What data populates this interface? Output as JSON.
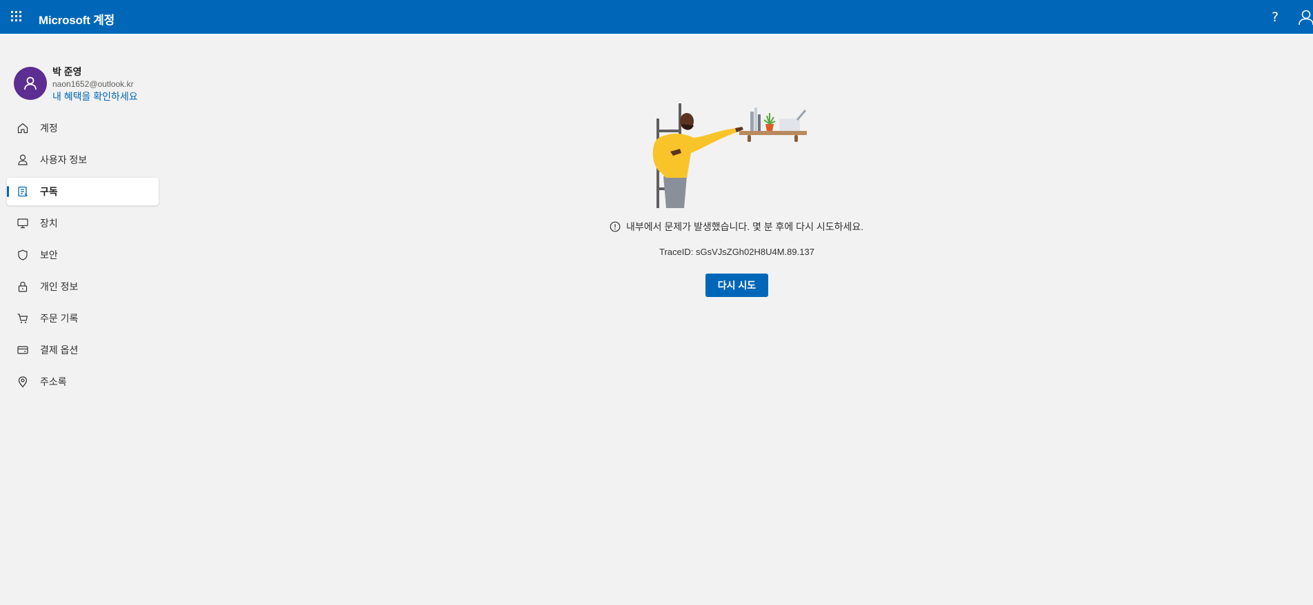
{
  "header": {
    "brand": "Microsoft 계정",
    "help": "?"
  },
  "profile": {
    "name": "박 준영",
    "email": "naon1652@outlook.kr",
    "benefits_link": "내 혜택을 확인하세요",
    "avatar_color": "#5c2e91"
  },
  "nav": {
    "items": [
      {
        "label": "계정",
        "icon": "home-icon"
      },
      {
        "label": "사용자 정보",
        "icon": "person-icon"
      },
      {
        "label": "구독",
        "icon": "subscription-icon",
        "active": true
      },
      {
        "label": "장치",
        "icon": "device-icon"
      },
      {
        "label": "보안",
        "icon": "shield-icon"
      },
      {
        "label": "개인 정보",
        "icon": "lock-icon"
      },
      {
        "label": "주문 기록",
        "icon": "cart-icon"
      },
      {
        "label": "결제 옵션",
        "icon": "card-icon"
      },
      {
        "label": "주소록",
        "icon": "location-icon"
      }
    ]
  },
  "main": {
    "error_message": "내부에서 문제가 발생했습니다. 몇 분 후에 다시 시도하세요.",
    "trace_id": "TraceID: sGsVJsZGh02H8U4M.89.137",
    "retry_label": "다시 시도"
  },
  "colors": {
    "topbar": "#0067b8",
    "accent": "#0067b8",
    "background": "#f2f2f2"
  }
}
